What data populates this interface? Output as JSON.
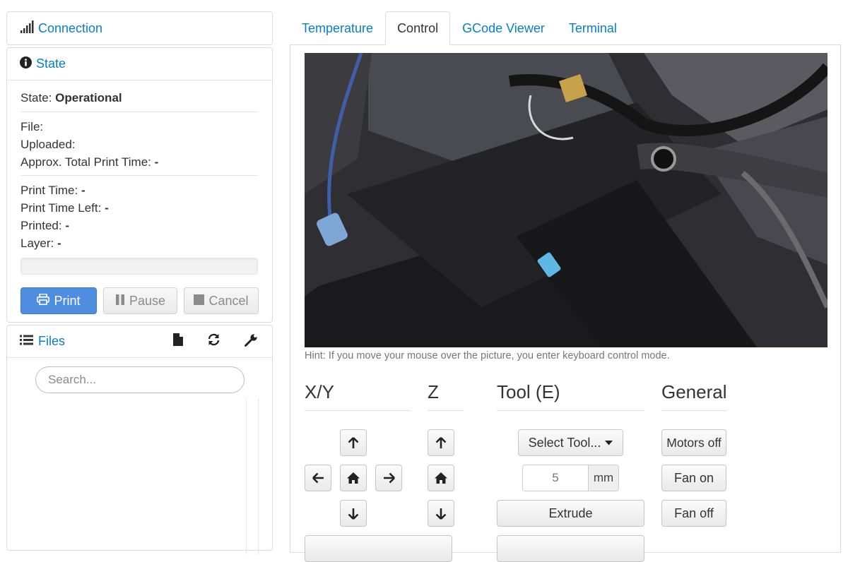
{
  "sidebar": {
    "connection": {
      "title": "Connection"
    },
    "state": {
      "title": "State",
      "state_label": "State:",
      "state_value": "Operational",
      "file_label": "File:",
      "uploaded_label": "Uploaded:",
      "approx_label": "Approx. Total Print Time:",
      "approx_value": "-",
      "print_time_label": "Print Time:",
      "print_time_value": "-",
      "time_left_label": "Print Time Left:",
      "time_left_value": "-",
      "printed_label": "Printed:",
      "printed_value": "-",
      "layer_label": "Layer:",
      "layer_value": "-",
      "progress_percent": 0,
      "buttons": {
        "print": "Print",
        "pause": "Pause",
        "cancel": "Cancel"
      }
    },
    "files": {
      "title": "Files",
      "search_placeholder": "Search...",
      "tool_icons": [
        "file-icon",
        "refresh-icon",
        "wrench-icon"
      ]
    }
  },
  "tabs": [
    {
      "label": "Temperature",
      "active": false
    },
    {
      "label": "Control",
      "active": true
    },
    {
      "label": "GCode Viewer",
      "active": false
    },
    {
      "label": "Terminal",
      "active": false
    }
  ],
  "control": {
    "hint": "Hint: If you move your mouse over the picture, you enter keyboard control mode.",
    "sections": {
      "xy": "X/Y",
      "z": "Z",
      "tool": "Tool (E)",
      "general": "General"
    },
    "tool": {
      "select_label": "Select Tool...",
      "amount_value": "5",
      "amount_unit": "mm",
      "extrude_label": "Extrude"
    },
    "general": {
      "motors_off": "Motors off",
      "fan_on": "Fan on",
      "fan_off": "Fan off"
    }
  },
  "colors": {
    "link": "#0a7fc0",
    "primary_button": "#4f8de0"
  }
}
